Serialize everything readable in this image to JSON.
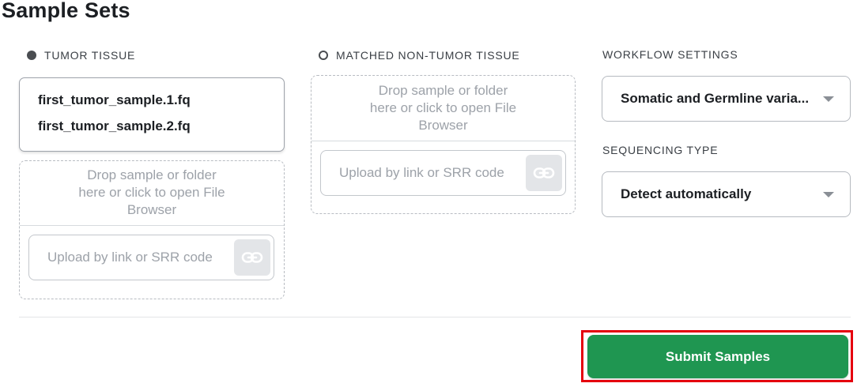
{
  "page": {
    "title": "Sample Sets"
  },
  "tumor": {
    "header": "TUMOR TISSUE",
    "files": [
      "first_tumor_sample.1.fq",
      "first_tumor_sample.2.fq"
    ],
    "drop_line1": "Drop sample or folder",
    "drop_line2": "here or click to open File",
    "drop_line3": "Browser",
    "link_placeholder": "Upload by link or SRR code",
    "link_icon": "link-icon"
  },
  "normal": {
    "header": "MATCHED NON-TUMOR TISSUE",
    "drop_line1": "Drop sample or folder",
    "drop_line2": "here or click to open File",
    "drop_line3": "Browser",
    "link_placeholder": "Upload by link or SRR code",
    "link_icon": "link-icon"
  },
  "workflow": {
    "label": "WORKFLOW SETTINGS",
    "value": "Somatic and Germline varia..."
  },
  "sequencing": {
    "label": "SEQUENCING TYPE",
    "value": "Detect automatically"
  },
  "actions": {
    "submit_label": "Submit Samples"
  },
  "colors": {
    "accent_green": "#1f9651",
    "highlight_red": "#e5000e",
    "border": "#b6bac0"
  }
}
